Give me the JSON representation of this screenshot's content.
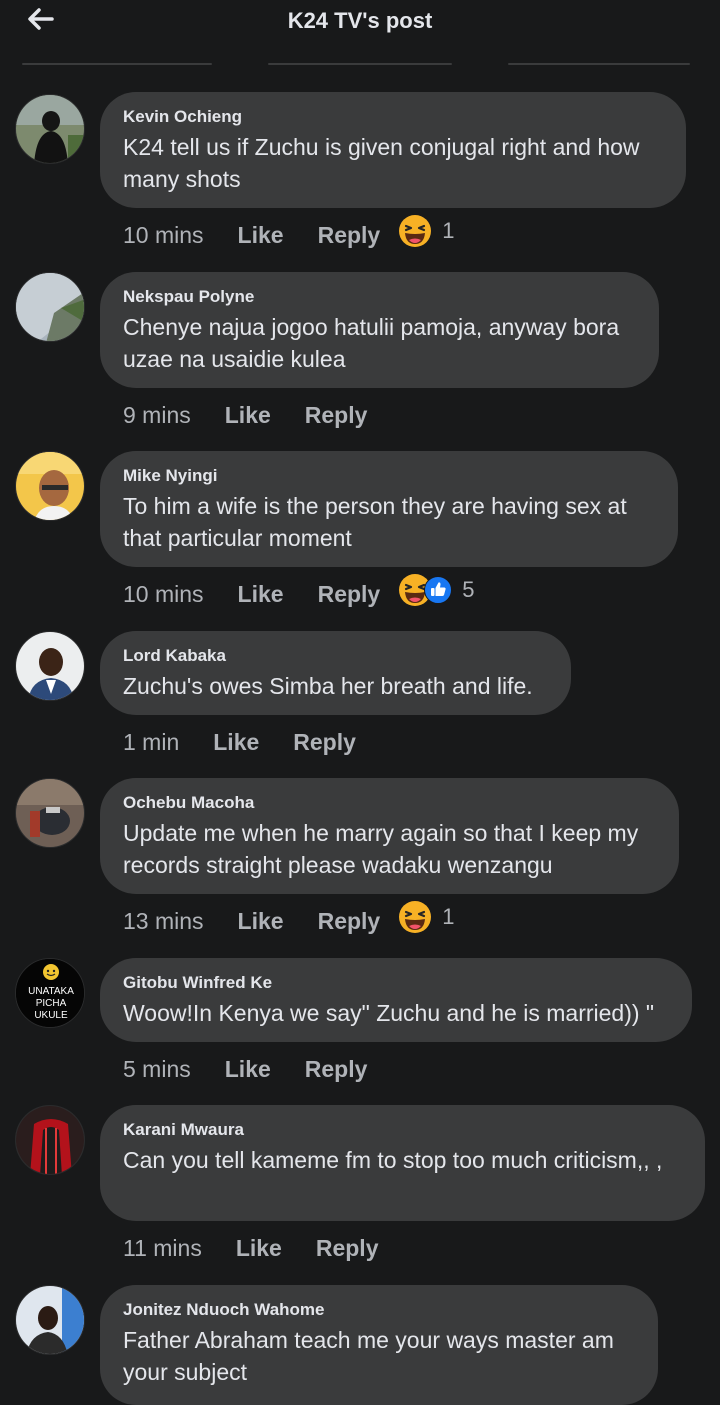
{
  "header": {
    "title": "K24 TV's post"
  },
  "comments": [
    {
      "author": "Kevin Ochieng",
      "text": "K24 tell us if Zuchu is given conjugal right and how many shots",
      "time": "10 mins",
      "like": "Like",
      "reply": "Reply",
      "reaction_count": "1",
      "reactions": [
        "haha-icon"
      ]
    },
    {
      "author": "Nekspau Polyne",
      "text": "Chenye najua jogoo hatulii pamoja, anyway bora uzae na usaidie kulea",
      "time": "9 mins",
      "like": "Like",
      "reply": "Reply"
    },
    {
      "author": "Mike Nyingi",
      "text": "To him a wife is the person they are having  sex at that particular moment",
      "time": "10 mins",
      "like": "Like",
      "reply": "Reply",
      "reaction_count": "5",
      "reactions": [
        "haha-icon",
        "thumbs-up-icon"
      ]
    },
    {
      "author": "Lord Kabaka",
      "text": "Zuchu's owes Simba her breath and life.",
      "time": "1 min",
      "like": "Like",
      "reply": "Reply"
    },
    {
      "author": "Ochebu Macoha",
      "text": "Update me when he marry again so that I keep my records straight please wadaku wenzangu",
      "time": "13 mins",
      "like": "Like",
      "reply": "Reply",
      "reaction_count": "1",
      "reactions": [
        "haha-icon"
      ]
    },
    {
      "author": "Gitobu Winfred Ke",
      "text": "Woow!In Kenya we say\" Zuchu and he is married)) \"",
      "time": "5 mins",
      "like": "Like",
      "reply": "Reply",
      "avatar_text": [
        "UNATAKA",
        "PICHA",
        "UKULE"
      ]
    },
    {
      "author": "Karani Mwaura",
      "text": "Can you tell kameme fm to stop too much criticism,, ,",
      "time": "11 mins",
      "like": "Like",
      "reply": "Reply"
    },
    {
      "author": "Jonitez Nduoch Wahome",
      "text": "Father Abraham teach me your ways master am your subject"
    }
  ],
  "colors": {
    "background": "#18191a",
    "bubble": "#3a3b3c",
    "primary_text": "#e4e6eb",
    "secondary_text": "#b0b3b8",
    "like_blue": "#1877f2",
    "haha_yellow": "#f7b125"
  }
}
